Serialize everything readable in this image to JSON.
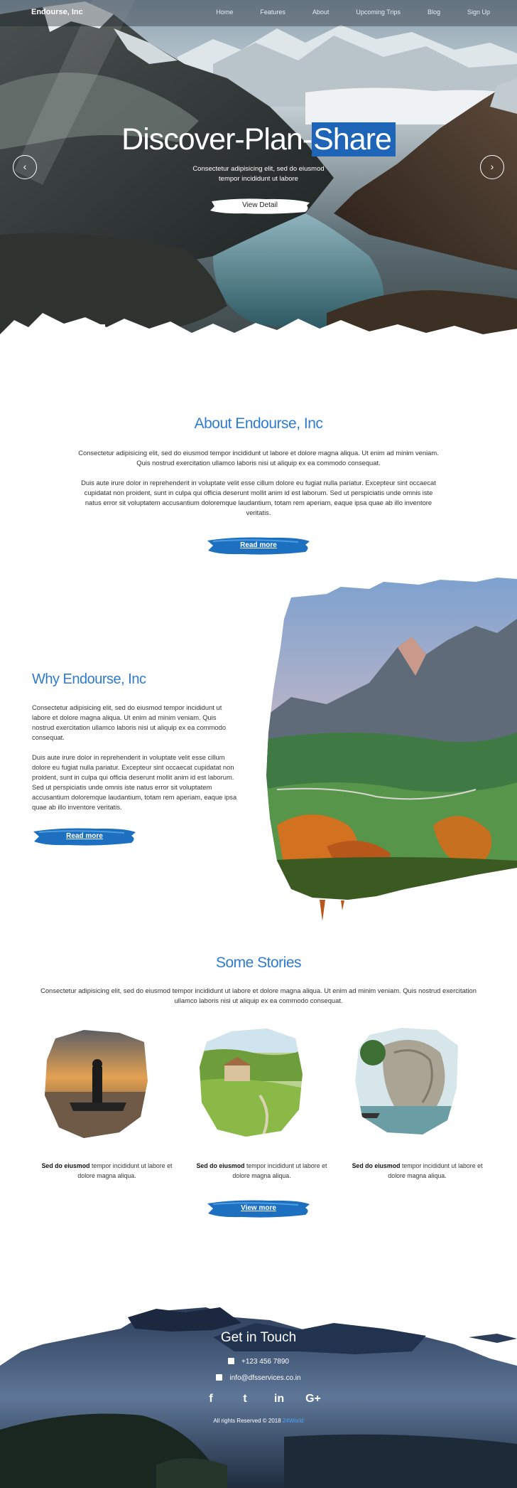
{
  "nav": {
    "brand": "Endourse, Inc",
    "links": [
      "Home",
      "Features",
      "About",
      "Upcoming Trips",
      "Blog",
      "Sign Up"
    ]
  },
  "hero": {
    "title_part1": "Discover-Plan-",
    "title_highlight": "Share",
    "subtitle_line1": "Consectetur adipisicing elit, sed do eiusmod",
    "subtitle_line2": "tempor incididunt ut labore",
    "button_label": "View Detail",
    "prev_icon": "chevron-left-icon",
    "next_icon": "chevron-right-icon"
  },
  "about": {
    "title": "About Endourse, Inc",
    "p1_line1": "Consectetur adipisicing elit, sed do eiusmod tempor incididunt ut labore et dolore magna aliqua. Ut enim ad minim veniam.",
    "p1_line2": "Quis nostrud exercitation ullamco laboris nisi ut aliquip ex ea commodo consequat.",
    "p2_line1": "Duis aute irure dolor in reprehenderit in voluptate velit esse cillum dolore eu fugiat nulla pariatur. Excepteur sint occaecat",
    "p2_line2": "cupidatat non proident, sunt in culpa qui officia deserunt mollit anim id est laborum. Sed ut perspiciatis unde omnis iste",
    "p2_line3": "natus error sit voluptatem accusantium doloremque laudantium, totam rem aperiam, eaque ipsa quae ab illo inventore",
    "p2_line4": "veritatis.",
    "button_label": "Read more"
  },
  "why": {
    "title": "Why Endourse, Inc",
    "p1_lines": [
      "Consectetur adipisicing elit, sed do eiusmod tempor incididunt ut",
      "labore et dolore magna aliqua. Ut enim ad minim veniam. Quis",
      "nostrud exercitation ullamco laboris nisi ut aliquip ex ea commodo",
      "consequat."
    ],
    "p2_lines": [
      "Duis aute irure dolor in reprehenderit in voluptate velit esse cillum",
      "dolore eu fugiat nulla pariatur. Excepteur sint occaecat cupidatat non",
      "proident, sunt in culpa qui officia deserunt mollit anim id est laborum.",
      "Sed ut perspiciatis unde omnis iste natus error sit voluptatem",
      "accusantium doloremque laudantium, totam rem aperiam, eaque ipsa",
      "quae ab illo inventore veritatis."
    ],
    "button_label": "Read more"
  },
  "stories": {
    "title": "Some Stories",
    "intro_line1": "Consectetur adipisicing elit, sed do eiusmod tempor incididunt ut labore et dolore magna aliqua. Ut enim ad minim veniam. Quis nostrud exercitation",
    "intro_line2": "ullamco laboris nisi ut aliquip ex ea commodo consequat.",
    "items": [
      {
        "bold": "Sed do eiusmod",
        "rest": " tempor incididunt ut labore et",
        "line2": "dolore magna aliqua."
      },
      {
        "bold": "Sed do eiusmod",
        "rest": " tempor incididunt ut labore et",
        "line2": "dolore magna aliqua."
      },
      {
        "bold": "Sed do eiusmod",
        "rest": " tempor incididunt ut labore et",
        "line2": "dolore magna aliqua."
      }
    ],
    "button_label": "View more"
  },
  "footer": {
    "title": "Get in Touch",
    "phone": "+123 456 7890",
    "email": "info@dfsservices.co.in",
    "socials": [
      "f",
      "t",
      "in",
      "G+"
    ],
    "social_icons": [
      "facebook-icon",
      "twitter-icon",
      "linkedin-icon",
      "google-plus-icon"
    ],
    "copyright": "All rights Reserved © 2018",
    "copyright_brand": "24World"
  },
  "colors": {
    "accent": "#2f7bd2",
    "highlight": "#1e64b7",
    "brush_blue": "#1d6fc0"
  }
}
